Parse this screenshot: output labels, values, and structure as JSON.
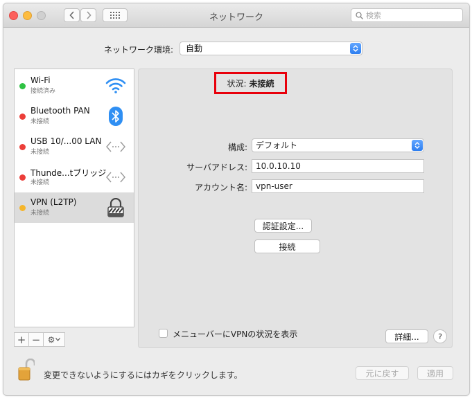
{
  "window": {
    "title": "ネットワーク",
    "search_placeholder": "検索"
  },
  "location": {
    "label": "ネットワーク環境:",
    "value": "自動"
  },
  "services": [
    {
      "name": "Wi-Fi",
      "status": "接続済み",
      "dot_color": "#2fc243",
      "icon": "wifi-icon"
    },
    {
      "name": "Bluetooth PAN",
      "status": "未接続",
      "dot_color": "#ec3e39",
      "icon": "bluetooth-icon"
    },
    {
      "name": "USB 10/...00 LAN",
      "status": "未接続",
      "dot_color": "#ec3e39",
      "icon": "ethernet-arrows-icon"
    },
    {
      "name": "Thunde...tブリッジ",
      "status": "未接続",
      "dot_color": "#ec3e39",
      "icon": "ethernet-arrows-icon"
    },
    {
      "name": "VPN (L2TP)",
      "status": "未接続",
      "dot_color": "#f5b52a",
      "icon": "vpn-lock-icon"
    }
  ],
  "sidebar_tools": {
    "add": "+",
    "remove": "−",
    "gear": "⚙"
  },
  "detail": {
    "status_label": "状況:",
    "status_value": "未接続",
    "config_label": "構成:",
    "config_value": "デフォルト",
    "server_label": "サーバアドレス:",
    "server_value": "10.0.10.10",
    "account_label": "アカウント名:",
    "account_value": "vpn-user",
    "auth_button": "認証設定...",
    "connect_button": "接続",
    "show_vpn_label": "メニューバーにVPNの状況を表示",
    "advanced_button": "詳細...",
    "help_button": "?"
  },
  "footer": {
    "lock_text": "変更できないようにするにはカギをクリックします。",
    "revert_button": "元に戻す",
    "apply_button": "適用"
  },
  "colors": {
    "accent": "#2d7ef0",
    "highlight": "#e8000b"
  }
}
